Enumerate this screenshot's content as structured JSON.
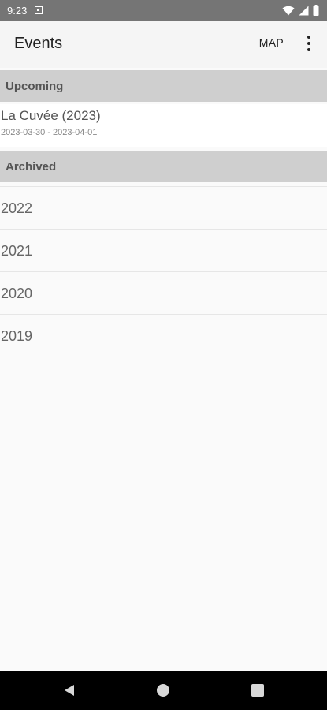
{
  "status_bar": {
    "time": "9:23"
  },
  "app_bar": {
    "title": "Events",
    "map_label": "MAP"
  },
  "sections": {
    "upcoming": {
      "label": "Upcoming"
    },
    "archived": {
      "label": "Archived"
    }
  },
  "upcoming_events": [
    {
      "title": "La Cuvée (2023)",
      "dates": "2023-03-30 - 2023-04-01"
    }
  ],
  "archived_years": [
    "2022",
    "2021",
    "2020",
    "2019"
  ]
}
